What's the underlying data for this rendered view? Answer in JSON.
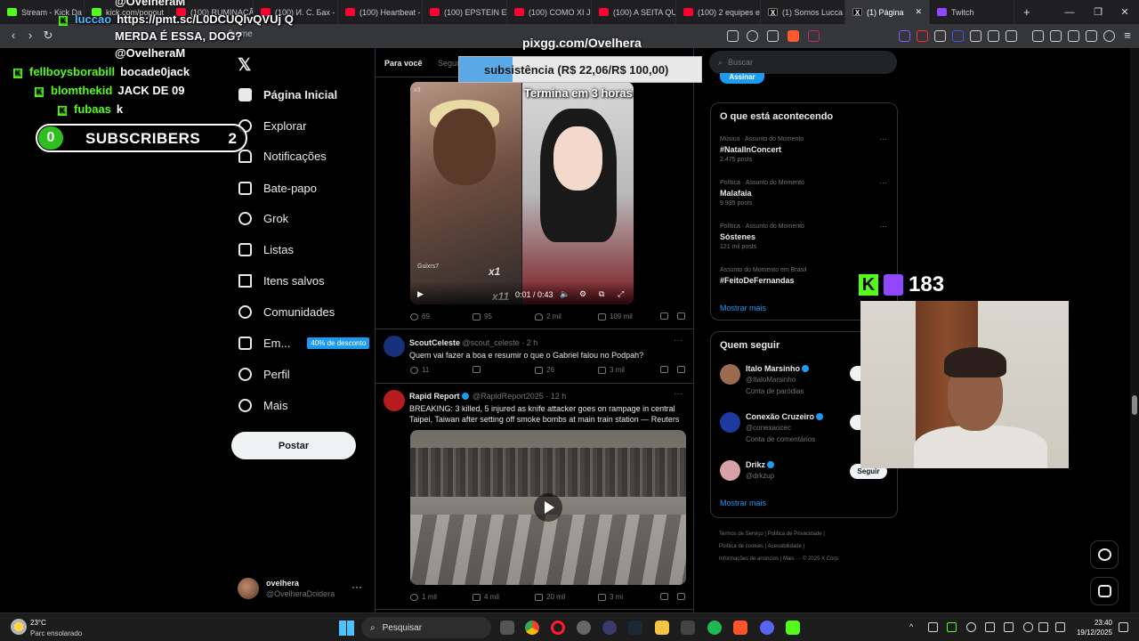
{
  "browser": {
    "tabs": [
      {
        "label": "Stream - Kick Da",
        "color": "#53fc18"
      },
      {
        "label": "kick.com/popout",
        "color": "#53fc18"
      },
      {
        "label": "(100) RUMINAÇÃ",
        "color": "#ff0033"
      },
      {
        "label": "(100) И. С. Бах -",
        "color": "#ff0033"
      },
      {
        "label": "(100) Heartbeat -",
        "color": "#ff0033"
      },
      {
        "label": "(100) EPSTEIN ES",
        "color": "#ff0033"
      },
      {
        "label": "(100) COMO XI J",
        "color": "#ff0033"
      },
      {
        "label": "(100) A SEITA QU",
        "color": "#ff0033"
      },
      {
        "label": "(100) 2 equipes e",
        "color": "#ff0033"
      },
      {
        "label": "(1) Somos Lucca",
        "color": "#000000"
      },
      {
        "label": "(1) Página",
        "color": "#000000"
      },
      {
        "label": "Twitch",
        "color": "#9146ff"
      }
    ],
    "url": "/home"
  },
  "nav": {
    "home": "Página Inicial",
    "explore": "Explorar",
    "notifications": "Notificações",
    "messages": "Bate-papo",
    "grok": "Grok",
    "lists": "Listas",
    "bookmarks": "Itens salvos",
    "communities": "Comunidades",
    "premium": "Em...",
    "premium_badge": "40% de desconto",
    "profile": "Perfil",
    "more": "Mais",
    "post_button": "Postar"
  },
  "account": {
    "name": "ovelhera",
    "handle": "@OvelheraDoidera"
  },
  "feed": {
    "tabs": [
      "Para você",
      "Segui"
    ],
    "video1": {
      "overlay_user": "Guixrs7",
      "time": "0:01 / 0:43",
      "counter": "x1",
      "counter2": "x11",
      "tag": "x3",
      "stats": {
        "replies": "69",
        "reposts": "95",
        "likes": "2 mil",
        "views": "109 mil"
      }
    },
    "tweets": [
      {
        "name": "ScoutCeleste",
        "handle": "@scout_celeste · 2 h",
        "text": "Quem vai fazer a boa e resumir o que o Gabriel falou no Podpah?",
        "stats": {
          "replies": "11",
          "reposts": "",
          "likes": "26",
          "views": "3 mil"
        }
      },
      {
        "name": "Rapid Report",
        "handle": "@RapidReport2025 · 12 h",
        "text": "BREAKING: 3 killed, 5 injured as knife attacker goes on rampage in central Taipei, Taiwan after setting off smoke bombs at main train station — Reuters",
        "stats": {
          "replies": "1 mil",
          "reposts": "4 mil",
          "likes": "20 mil",
          "views": "3 mi"
        }
      }
    ]
  },
  "sidebar": {
    "search_placeholder": "Buscar",
    "subscribe": "Assinar",
    "trends_title": "O que está acontecendo",
    "trends": [
      {
        "category": "Música · Assunto do Momento",
        "title": "#NatalInConcert",
        "count": "2.475 posts"
      },
      {
        "category": "Política · Assunto do Momento",
        "title": "Malafaia",
        "count": "9.935 posts"
      },
      {
        "category": "Política · Assunto do Momento",
        "title": "Sóstenes",
        "count": "121 mil posts"
      },
      {
        "category": "Assunto do Momento em Brasil",
        "title": "#FeitoDeFernandas",
        "count": ""
      }
    ],
    "show_more": "Mostrar mais",
    "follow_title": "Quem seguir",
    "people": [
      {
        "name": "Italo Marsinho",
        "handle": "@ItaloMarsinho",
        "label": "Conta de paródias",
        "btn": "S"
      },
      {
        "name": "Conexão Cruzeiro",
        "handle": "@conexaocec",
        "label": "Conta de comentários",
        "btn": "S"
      },
      {
        "name": "Drikz",
        "handle": "@drkzup",
        "label": "",
        "btn": "Seguir"
      }
    ],
    "footer": [
      "Termos de Serviço",
      "|",
      "Política de Privacidade",
      "|",
      "Política de cookies",
      "|",
      "Acessibilidade",
      "|",
      "Informações de anúncios",
      "|",
      "Mais ···",
      "© 2025 X Corp."
    ]
  },
  "stream_overlay": {
    "chat": [
      {
        "user": "",
        "text": "@OvelheraM",
        "kick": false
      },
      {
        "user": "luccao",
        "text": "https://pmt.sc/L0DCUQlvQVUj Q",
        "kick": true,
        "blue": true
      },
      {
        "user": "",
        "text": "MERDA É ESSA, DOG?",
        "kick": false
      },
      {
        "user": "",
        "text": "@OvelheraM",
        "kick": false
      },
      {
        "user": "fellboysborabill",
        "text": "bocade0jack",
        "kick": true
      },
      {
        "user": "blomthekid",
        "text": "JACK DE 09",
        "kick": true
      },
      {
        "user": "fubaas",
        "text": "k",
        "kick": true
      }
    ],
    "sub_counter": {
      "left": "0",
      "label": "SUBSCRIBERS",
      "right": "2"
    },
    "pix_url": "pixgg.com/Ovelhera",
    "goal": {
      "text": "subsistência (R$ 22,06/R$ 100,00)",
      "progress": 0.2206
    },
    "timer": "Termina em 3 horas",
    "viewers": "183"
  },
  "taskbar": {
    "weather_temp": "23°C",
    "weather_desc": "Parc ensolarado",
    "search": "Pesquisar",
    "time": "23:40",
    "date": "19/12/2025"
  }
}
